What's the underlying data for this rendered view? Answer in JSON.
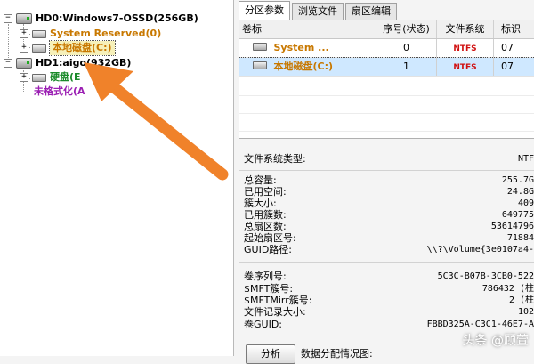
{
  "tree": {
    "hd0_label": "HD0:Windows7-OSSD(256GB)",
    "hd0_children": [
      {
        "label": "System Reserved(0)"
      },
      {
        "label": "本地磁盘(C:)"
      }
    ],
    "hd1_label": "HD1:aigo(932GB)",
    "hd1_children": [
      {
        "label": "硬盘(E"
      },
      {
        "label": "未格式化(A"
      }
    ]
  },
  "tabs": [
    {
      "label": "分区参数",
      "active": true
    },
    {
      "label": "浏览文件",
      "active": false
    },
    {
      "label": "扇区编辑",
      "active": false
    }
  ],
  "grid": {
    "columns": [
      "卷标",
      "序号(状态)",
      "文件系统",
      "标识"
    ],
    "rows": [
      {
        "label": "System ...",
        "index": "0",
        "fs": "NTFS",
        "flag": "07"
      },
      {
        "label": "本地磁盘(C:)",
        "index": "1",
        "fs": "NTFS",
        "flag": "07"
      }
    ]
  },
  "props": {
    "fs_type": {
      "label": "文件系统类型:",
      "value": "NTF"
    },
    "group1": [
      {
        "label": "总容量:",
        "value": "255.7G"
      },
      {
        "label": "已用空间:",
        "value": "24.8G"
      },
      {
        "label": "簇大小:",
        "value": "409"
      },
      {
        "label": "已用簇数:",
        "value": "649775"
      },
      {
        "label": "总扇区数:",
        "value": "53614796"
      },
      {
        "label": "起始扇区号:",
        "value": "71884"
      },
      {
        "label": "GUID路径:",
        "value": "\\\\?\\Volume{3e0107a4-"
      }
    ],
    "group2": [
      {
        "label": "卷序列号:",
        "value": "5C3C-B07B-3CB0-522"
      },
      {
        "label": "$MFT簇号:",
        "value": "786432 (柱"
      },
      {
        "label": "$MFTMirr簇号:",
        "value": "2 (柱"
      },
      {
        "label": "文件记录大小:",
        "value": "102"
      },
      {
        "label": "卷GUID:",
        "value": "FBBD325A-C3C1-46E7-A"
      }
    ]
  },
  "analyze": {
    "button_label": "分析",
    "label": "数据分配情况图:"
  },
  "watermark": "头条 @顾萱",
  "colors": {
    "arrow": "#f0822a",
    "selection": "#cfe8ff",
    "ntfs": "#d01010"
  }
}
